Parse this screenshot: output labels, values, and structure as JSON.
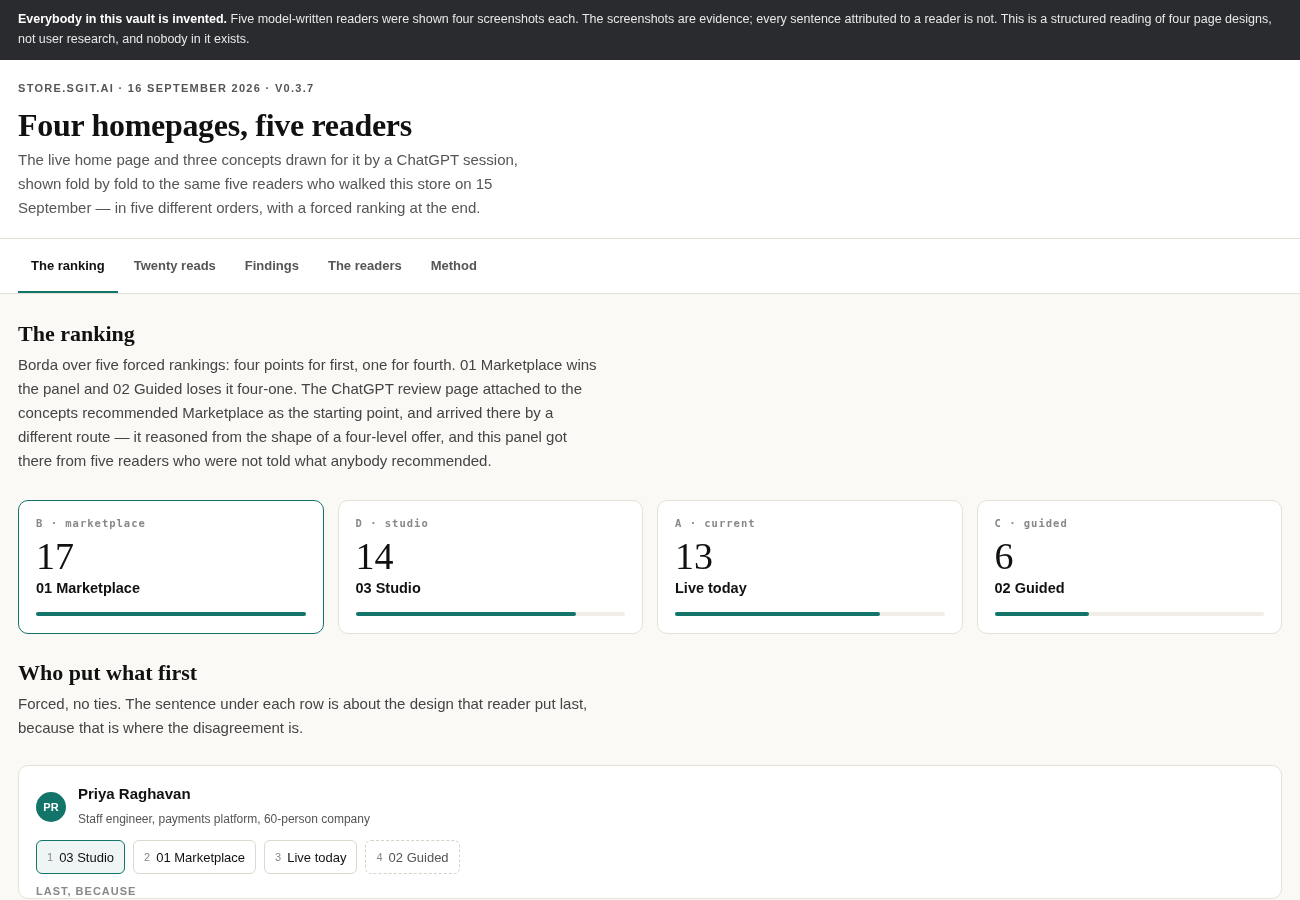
{
  "banner": {
    "text": "**Everybody in this vault is invented.** Five model-written readers were shown four screenshots each. The screenshots are evidence; every sentence attributed to a reader is not. This is a structured reading of four page designs, not user research, and nobody in it exists."
  },
  "header": {
    "meta": "STORE.SGIT.AI · 16 SEPTEMBER 2026 · V0.3.7",
    "title": "Four homepages, five readers",
    "subtitle": "The live home page and three concepts drawn for it by a ChatGPT session, shown fold by fold to the same five readers who walked this store on 15 September — in five different orders, with a forced ranking at the end."
  },
  "tabs": [
    {
      "label": "The ranking",
      "selected": true
    },
    {
      "label": "Twenty reads",
      "selected": false
    },
    {
      "label": "Findings",
      "selected": false
    },
    {
      "label": "The readers",
      "selected": false
    },
    {
      "label": "Method",
      "selected": false
    }
  ],
  "ranking": {
    "title": "The ranking",
    "text": "Borda over five forced rankings: four points for first, one for fourth. 01 Marketplace wins the panel and 02 Guided loses it four-one. The ChatGPT review page attached to the concepts recommended Marketplace as the starting point, and arrived there by a different route — it reasoned from the shape of a four-level offer, and this panel got there from five readers who were not told what anybody recommended.",
    "cards": [
      {
        "code": "B · marketplace",
        "score": "17",
        "name": "01 Marketplace",
        "level": 1.0,
        "selected": true
      },
      {
        "code": "D · studio",
        "score": "14",
        "name": "03 Studio",
        "level": 0.82,
        "selected": false
      },
      {
        "code": "A · current",
        "score": "13",
        "name": "Live today",
        "level": 0.76,
        "selected": false
      },
      {
        "code": "C · guided",
        "score": "6",
        "name": "02 Guided",
        "level": 0.35,
        "selected": false
      }
    ]
  },
  "who_first": {
    "title": "Who put what first",
    "text": "Forced, no ties. The sentence under each row is about the design that reader put last, because that is where the disagreement is.",
    "readers": [
      {
        "initials": "PR",
        "name": "Priya Raghavan",
        "role": "Staff engineer, payments platform, 60-person company",
        "order": [
          {
            "rank": "1",
            "label": "03 Studio",
            "kind": "first"
          },
          {
            "rank": "2",
            "label": "01 Marketplace",
            "kind": "middle"
          },
          {
            "rank": "3",
            "label": "Live today",
            "kind": "middle"
          },
          {
            "rank": "4",
            "label": "02 Guided",
            "kind": "last"
          }
        ],
        "last_label": "LAST, BECAUSE"
      }
    ]
  }
}
